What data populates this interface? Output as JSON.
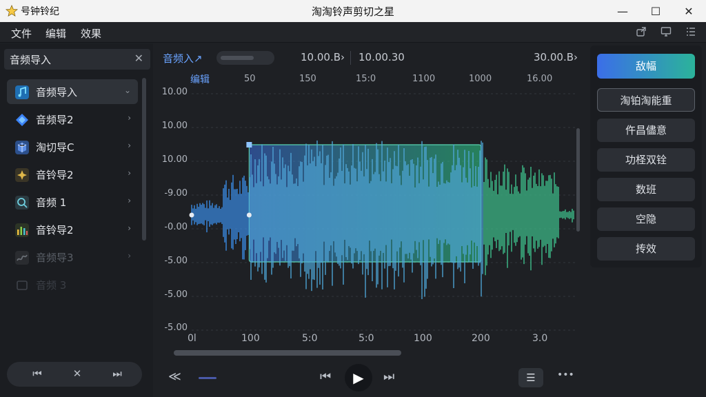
{
  "app": {
    "name": "号钟铃纪",
    "window_title": "淘淘铃声剪切之星"
  },
  "window_controls": {
    "minimize": "—",
    "maximize": "☐",
    "close": "✕"
  },
  "menu": [
    "文件",
    "编辑",
    "效果"
  ],
  "toolbar_icons": [
    "share-icon",
    "monitor-icon",
    "list-icon"
  ],
  "left_panel": {
    "title": "音频导入",
    "close": "✕",
    "items": [
      {
        "label": "音频导入",
        "active": true,
        "icon": "music-note-icon",
        "color": "#3aa7e8"
      },
      {
        "label": "音频导2",
        "icon": "diamond-icon",
        "color": "#3b82f6"
      },
      {
        "label": "淘切导C",
        "icon": "cube-icon",
        "color": "#4a7fd8"
      },
      {
        "label": "音铃导2",
        "icon": "sparkle-icon",
        "color": "#c8a23a"
      },
      {
        "label": "音频 1",
        "icon": "search-icon",
        "color": "#4bb3c8"
      },
      {
        "label": "音铃导2",
        "icon": "equalizer-icon",
        "color": "#8bc34a"
      },
      {
        "label": "音频导3",
        "dim": true,
        "icon": "wave-icon",
        "color": "#555a61"
      },
      {
        "label": "音频 3",
        "dim2": true,
        "icon": "film-icon",
        "color": "#3b3f46"
      }
    ],
    "transport": [
      "⏮",
      "✕",
      "⏭"
    ]
  },
  "editor": {
    "track_label": "音频入↗",
    "timecodes": [
      "10.00.B›",
      "10.00.30",
      "30.00.B›"
    ],
    "ruler_label": "编辑",
    "ruler_ticks": [
      "50",
      "150",
      "15:0",
      "1100",
      "1000",
      "16.00"
    ],
    "y_labels": [
      "10.00",
      "10.00",
      "10.00",
      "-9.00",
      "-0.00",
      "-5.00",
      "-5.00",
      "-5.00"
    ],
    "x_labels": [
      "0l",
      "100",
      "5:0",
      "5:0",
      "100",
      "200",
      "3.0"
    ],
    "selection": {
      "start_frac": 0.15,
      "end_frac": 0.755
    }
  },
  "bottom": {
    "rewind": "≪",
    "prev": "⏮",
    "play": "▶",
    "next": "⏭",
    "mixer": "☰",
    "more": "•••"
  },
  "right_panel": {
    "buttons": [
      "敌幅",
      "淘铂淘能重",
      "仵昌儘意",
      "功柽双铨",
      "数班",
      "空隐",
      "抟效"
    ]
  }
}
